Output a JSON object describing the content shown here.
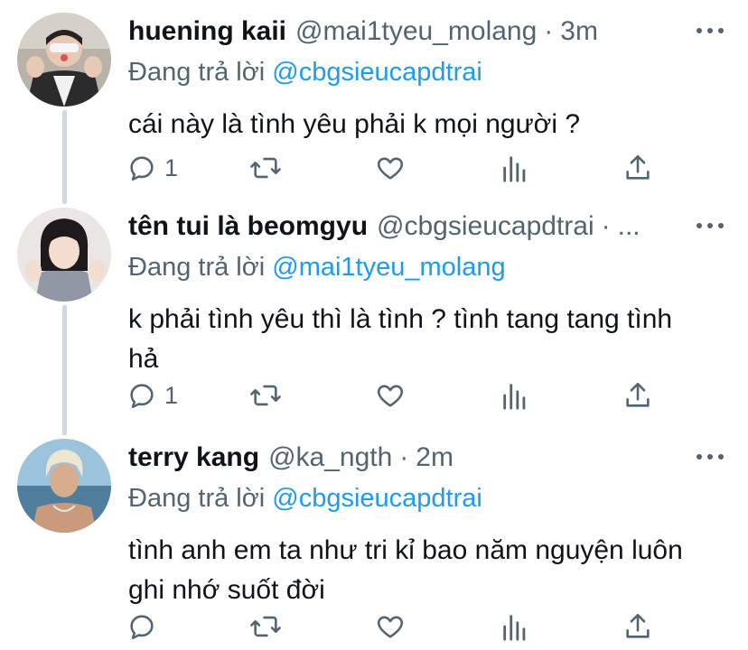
{
  "tweets": [
    {
      "display_name": "huening kaii",
      "handle": "@mai1tyeu_molang",
      "separator": "·",
      "time": "3m",
      "replying_prefix": "Đang trả lời ",
      "replying_to": "@cbgsieucapdtrai",
      "text": "cái này là tình yêu phải k mọi người ?",
      "reply_count": "1"
    },
    {
      "display_name": "tên tui là beomgyu",
      "handle": "@cbgsieucapdtrai",
      "separator": "·",
      "time": "...",
      "replying_prefix": "Đang trả lời ",
      "replying_to": "@mai1tyeu_molang",
      "text": "k phải tình yêu thì là tình ? tình tang tang tình hả",
      "reply_count": "1"
    },
    {
      "display_name": "terry kang",
      "handle": "@ka_ngth",
      "separator": "·",
      "time": "2m",
      "replying_prefix": "Đang trả lời ",
      "replying_to": "@cbgsieucapdtrai",
      "text": "tình anh em ta như tri kỉ bao năm nguyện luôn ghi nhớ suốt đời",
      "reply_count": ""
    }
  ],
  "icons": {
    "reply": "reply-icon",
    "retweet": "retweet-icon",
    "like": "like-icon",
    "analytics": "analytics-icon",
    "share": "share-icon",
    "more": "more-icon"
  },
  "colors": {
    "mention": "#1d9bf0",
    "secondary_text": "#536471",
    "primary_text": "#0f1419",
    "thread_line": "#cfd9de"
  }
}
